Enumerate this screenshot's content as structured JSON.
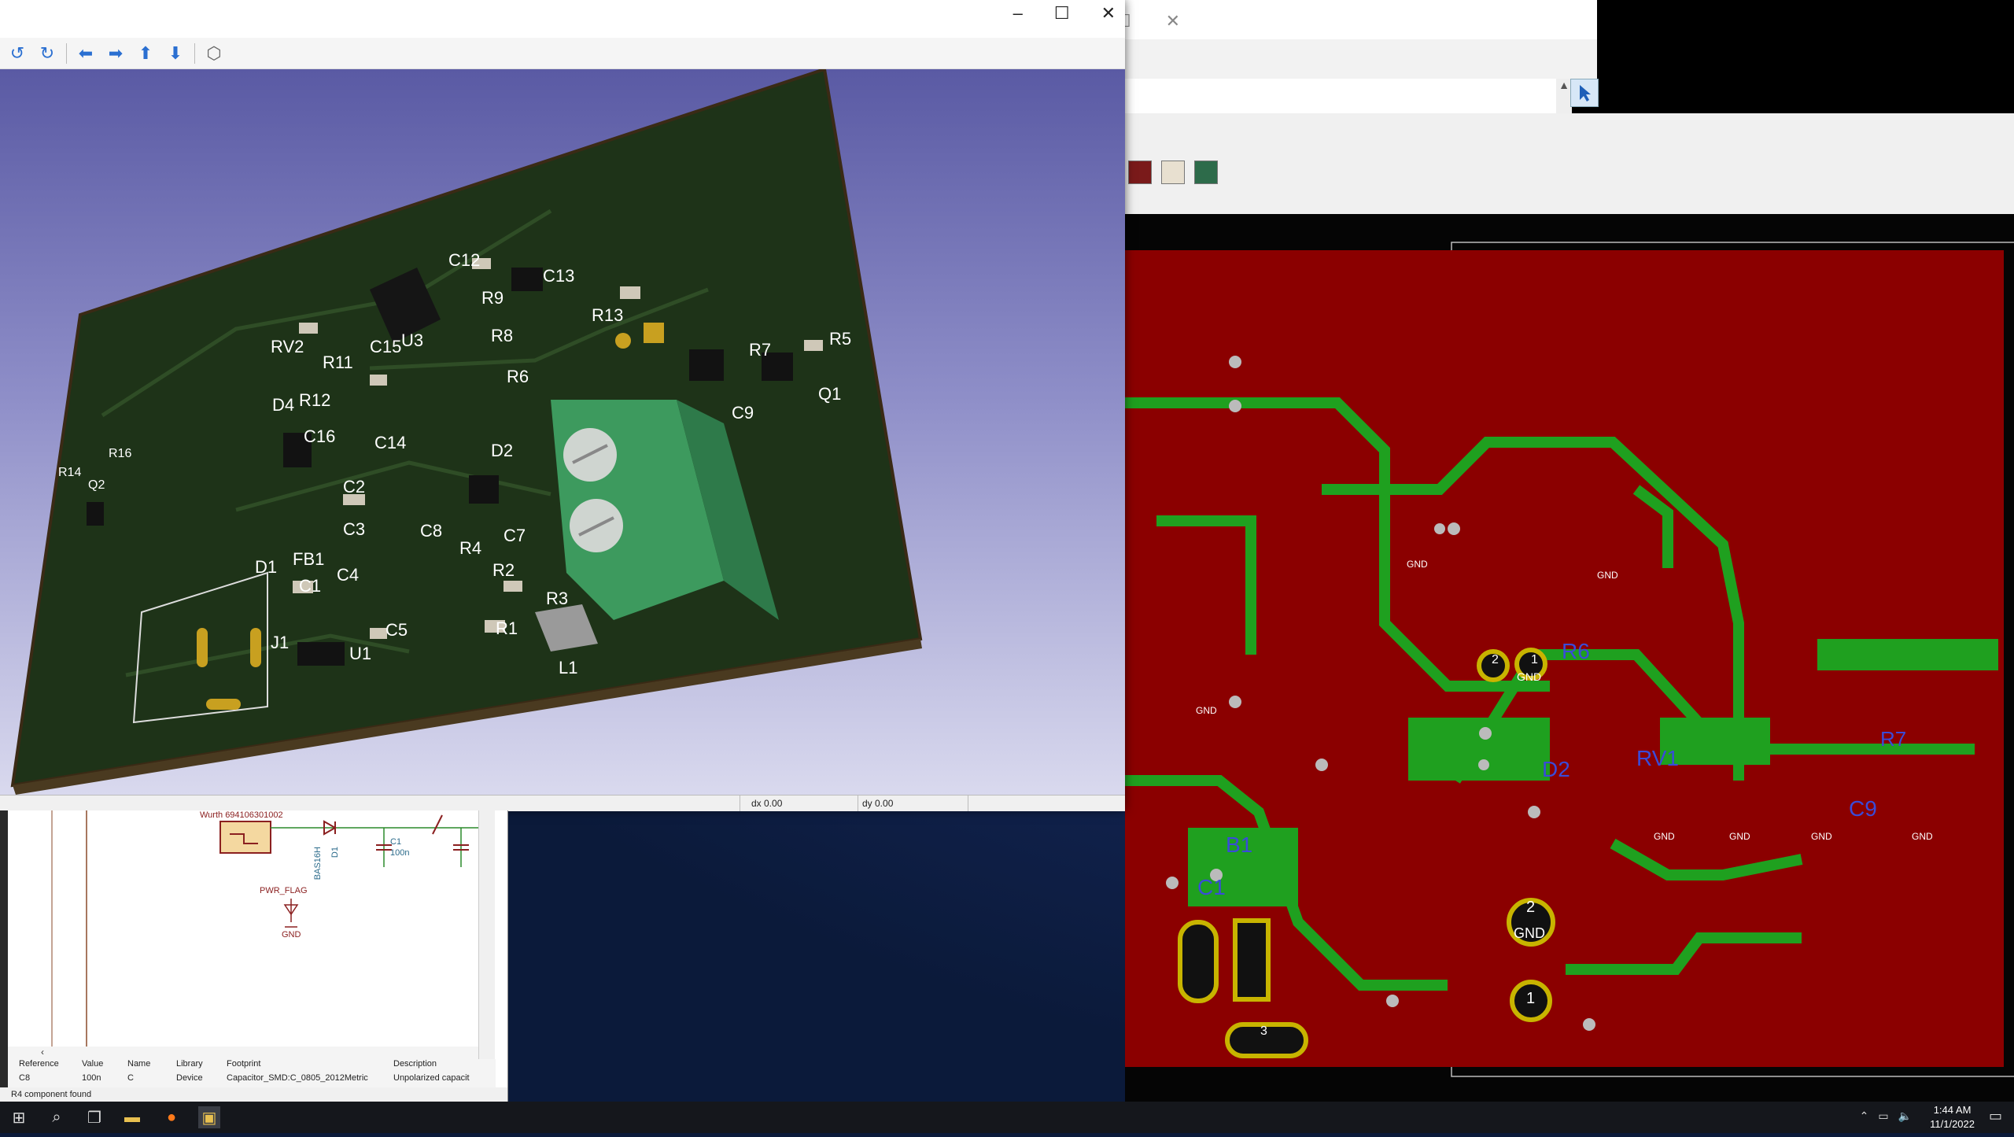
{
  "viewer": {
    "status": {
      "dx": "dx 0.00",
      "dy": "dy 0.00"
    },
    "board_labels": [
      "C12",
      "C13",
      "R9",
      "R13",
      "RV2",
      "R11",
      "C15",
      "U3",
      "R8",
      "R7",
      "R5",
      "R6",
      "D4",
      "R12",
      "C16",
      "C14",
      "C9",
      "Q1",
      "D2",
      "R16",
      "R14",
      "Q2",
      "C2",
      "C3",
      "C8",
      "R4",
      "C7",
      "D1",
      "FB1",
      "C1",
      "C4",
      "R2",
      "R3",
      "R1",
      "L1",
      "C5",
      "U1",
      "J1"
    ]
  },
  "pcb": {
    "labels": [
      "R6",
      "D2",
      "RV1",
      "B1",
      "C1",
      "R7",
      "C9",
      "GND",
      "GND",
      "GND",
      "GND",
      "GND",
      "GND",
      "GND",
      "GND",
      "GND",
      "1",
      "2",
      "3",
      "2",
      "1"
    ]
  },
  "schematic": {
    "texts": [
      "Wurth 694106301002",
      "BAS16H",
      "D1",
      "C1",
      "100n",
      "PWR_FLAG",
      "GND"
    ],
    "info": {
      "headers": [
        "Reference",
        "Value",
        "Name",
        "Library",
        "Footprint",
        "Description"
      ],
      "values": [
        "C8",
        "100n",
        "C",
        "Device",
        "Capacitor_SMD:C_0805_2012Metric",
        "Unpolarized capacit"
      ]
    },
    "status": "R4 component found"
  },
  "taskbar": {
    "time": "1:44 AM",
    "date": "11/1/2022"
  }
}
